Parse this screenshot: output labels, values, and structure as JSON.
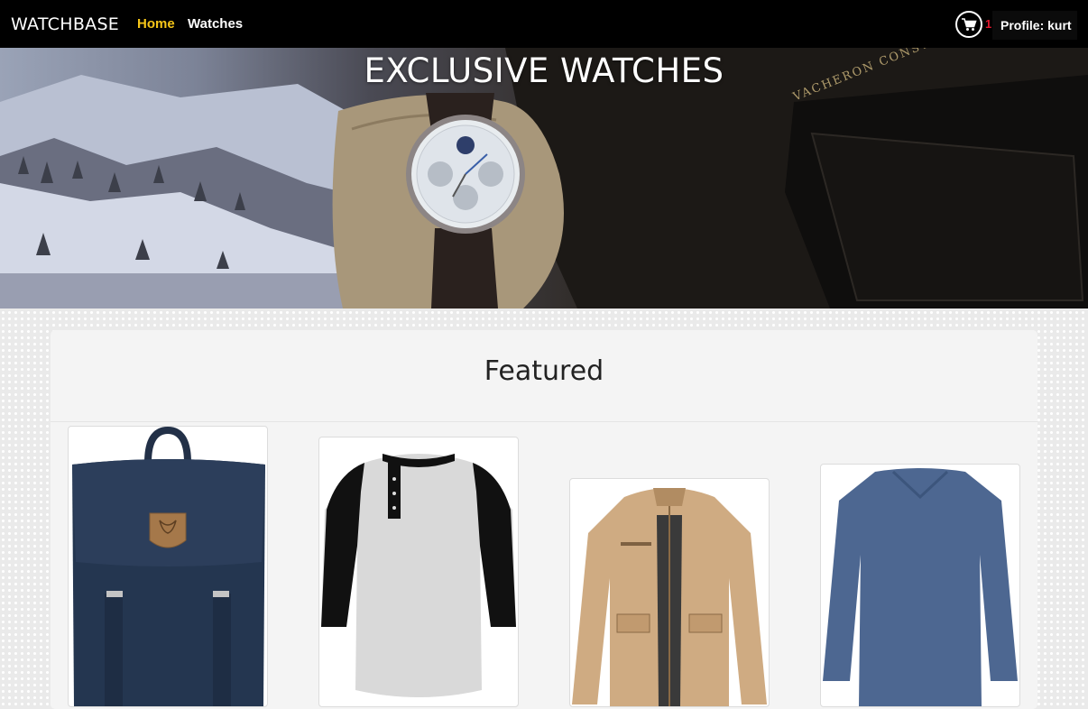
{
  "navbar": {
    "brand": "WATCHBASE",
    "links": [
      {
        "label": "Home",
        "active": true
      },
      {
        "label": "Watches",
        "active": false
      }
    ],
    "cart_icon": "shopping-cart-icon",
    "cart_count": "1",
    "profile_label": "Profile: kurt"
  },
  "hero": {
    "title": "EXCLUSIVE WATCHES",
    "box_brand": "VACHERON CONSTANTIN"
  },
  "featured": {
    "title": "Featured",
    "products": [
      {
        "name": "backpack",
        "image": "navy-backpack"
      },
      {
        "name": "raglan-henley-shirt",
        "image": "grey-black-henley"
      },
      {
        "name": "field-jacket",
        "image": "khaki-jacket"
      },
      {
        "name": "long-sleeve-vneck",
        "image": "blue-vneck"
      }
    ]
  },
  "colors": {
    "nav_bg": "#000000",
    "active_link": "#f5c518",
    "cart_badge": "#e0182e"
  }
}
